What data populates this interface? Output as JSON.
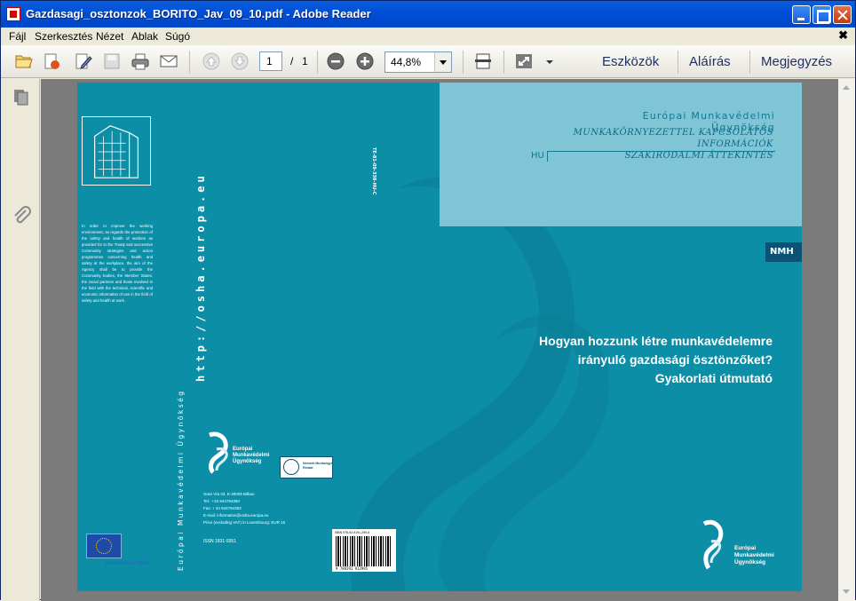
{
  "window": {
    "title": "Gazdasagi_osztonzok_BORITO_Jav_09_10.pdf - Adobe Reader"
  },
  "menu": {
    "items": [
      "Fájl",
      "Szerkesztés",
      "Nézet",
      "Ablak",
      "Súgó"
    ]
  },
  "toolbar": {
    "page_current": "1",
    "page_sep": "/",
    "page_total": "1",
    "zoom": "44,8%",
    "tools_label": "Eszközök",
    "sign_label": "Aláírás",
    "comment_label": "Megjegyzés"
  },
  "document": {
    "agency_name": "Európai Munkavédelmi Ügynökség",
    "kind_line1": "MUNKAKÖRNYEZETTEL KAPCSOLATOS",
    "kind_line2": "INFORMÁCIÓK",
    "kind_line3": "SZAKIRODALMI ÁTTEKINTÉS",
    "language": "HU",
    "badge": "NMH",
    "title_line1": "Hogyan hozzunk létre munkavédelemre",
    "title_line2": "irányuló gazdasági ösztönzőket?",
    "title_line3": "Gyakorlati útmutató",
    "spine_url": "http://osha.europa.eu",
    "spine_agency": "Európai Munkavédelmi Ügynökség",
    "spine_code": "TE-81-09-338-HU-C",
    "about_text": "In order to improve the working environment, as regards the protection of the safety and health of workers as provided for in the Treaty and successive Community strategies and action programmes concerning health and safety at the workplace, the aim of the Agency shall be to provide the Community bodies, the Member States, the social partners and those involved in the field with the technical, scientific and economic information of use in the field of safety and health at work.",
    "logo_line1": "Európai",
    "logo_line2": "Munkavédelmi",
    "logo_line3": "Ügynökség",
    "omm_text": "Nemzeti Munkaügyi Hivatal",
    "address1": "Gran Vía 33, E-48009 Bilbao",
    "address2": "Tel.: +34 944794360",
    "address3": "Fax: + 34 944794383",
    "address4": "E-mail: information@osha.europa.eu",
    "address5": "Price (excluding VAT) in Luxembourg: EUR 15",
    "issn": "ISSN 1831-9351",
    "isbn": "ISBN 978-92-9191-299-5",
    "barcode_number": "9 789291 912995",
    "publications_office": "Publications Office"
  }
}
